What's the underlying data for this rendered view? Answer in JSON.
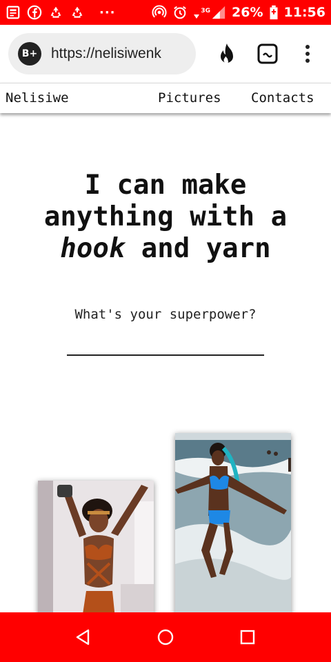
{
  "status_bar": {
    "icons_left": [
      "news-icon",
      "facebook-icon",
      "recycle-icon",
      "recycle-icon",
      "more-dots-icon"
    ],
    "icons_right": [
      "hotspot-icon",
      "alarm-icon",
      "wifi-icon",
      "signal-icon",
      "battery-icon"
    ],
    "network": "3G",
    "battery": "26%",
    "time": "11:56",
    "color": "#ff0000"
  },
  "browser": {
    "site_badge": "B+",
    "url": "https://nelisiwenk",
    "actions": [
      "fire-icon",
      "chat-icon",
      "more-vert-icon"
    ]
  },
  "site_nav": {
    "brand": "Nelisiwe",
    "items": [
      "Pictures",
      "Contacts"
    ]
  },
  "hero": {
    "title_line1": "I can make anything with",
    "title_word_a": "a",
    "title_italic": "hook",
    "title_rest": "and yarn",
    "subtitle": "What's your superpower?"
  },
  "gallery": {
    "photos": [
      {
        "name": "photo-crochet-outfit-orange"
      },
      {
        "name": "photo-crochet-bikini-beach"
      }
    ]
  },
  "system_nav": {
    "buttons": [
      "back-icon",
      "home-icon",
      "recents-icon"
    ],
    "color": "#ff0000"
  }
}
